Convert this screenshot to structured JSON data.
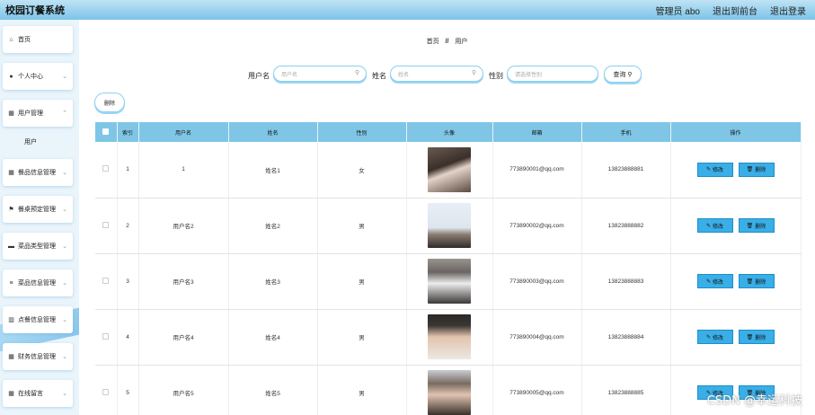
{
  "header": {
    "title": "校园订餐系统",
    "admin": "管理员 abo",
    "front": "退出到前台",
    "logout": "退出登录"
  },
  "sidebar": {
    "items": [
      {
        "label": "首页",
        "icon": "home-icon",
        "glyph": "⌂",
        "chev": false
      },
      {
        "label": "个人中心",
        "icon": "user-icon",
        "glyph": "👤",
        "chev": true
      },
      {
        "label": "用户管理",
        "icon": "grid-icon",
        "glyph": "▦",
        "chev": true
      },
      {
        "label": "餐品信息管理",
        "icon": "grid-icon",
        "glyph": "▦",
        "chev": true
      },
      {
        "label": "餐桌预定管理",
        "icon": "flag-icon",
        "glyph": "⚑",
        "chev": true
      },
      {
        "label": "菜品类型管理",
        "icon": "monitor-icon",
        "glyph": "▬",
        "chev": true
      },
      {
        "label": "菜品信息管理",
        "icon": "sliders-icon",
        "glyph": "≡",
        "chev": true
      },
      {
        "label": "点餐信息管理",
        "icon": "trash-icon",
        "glyph": "▥",
        "chev": true
      },
      {
        "label": "财务信息管理",
        "icon": "grid-icon",
        "glyph": "▦",
        "chev": true
      },
      {
        "label": "在线留言",
        "icon": "grid-icon",
        "glyph": "▦",
        "chev": true
      }
    ],
    "sub_item": "用户"
  },
  "breadcrumb": {
    "home": "首页",
    "sep": "//",
    "current": "用户"
  },
  "search": {
    "username_label": "用户名",
    "username_placeholder": "用户名",
    "name_label": "姓名",
    "name_placeholder": "姓名",
    "gender_label": "性别",
    "gender_placeholder": "请选择性别",
    "query_label": "查询"
  },
  "delete_button": "删除",
  "table": {
    "columns": [
      "索引",
      "用户名",
      "姓名",
      "性别",
      "头像",
      "邮箱",
      "手机",
      "操作"
    ],
    "rows": [
      {
        "index": "1",
        "username": "1",
        "name": "姓名1",
        "gender": "女",
        "email": "773890001@qq.com",
        "phone": "13823888881"
      },
      {
        "index": "2",
        "username": "用户名2",
        "name": "姓名2",
        "gender": "男",
        "email": "773890002@qq.com",
        "phone": "13823888882"
      },
      {
        "index": "3",
        "username": "用户名3",
        "name": "姓名3",
        "gender": "男",
        "email": "773890003@qq.com",
        "phone": "13823888883"
      },
      {
        "index": "4",
        "username": "用户名4",
        "name": "姓名4",
        "gender": "男",
        "email": "773890004@qq.com",
        "phone": "13823888884"
      },
      {
        "index": "5",
        "username": "用户名5",
        "name": "姓名5",
        "gender": "男",
        "email": "773890005@qq.com",
        "phone": "13823888885"
      }
    ],
    "edit_label": "修改",
    "delete_label": "删除"
  },
  "watermark": "CSDN @幸运科技",
  "colors": {
    "accent": "#3aaee6",
    "header": "#7cc4e8",
    "table_head": "#7fc6e6"
  }
}
